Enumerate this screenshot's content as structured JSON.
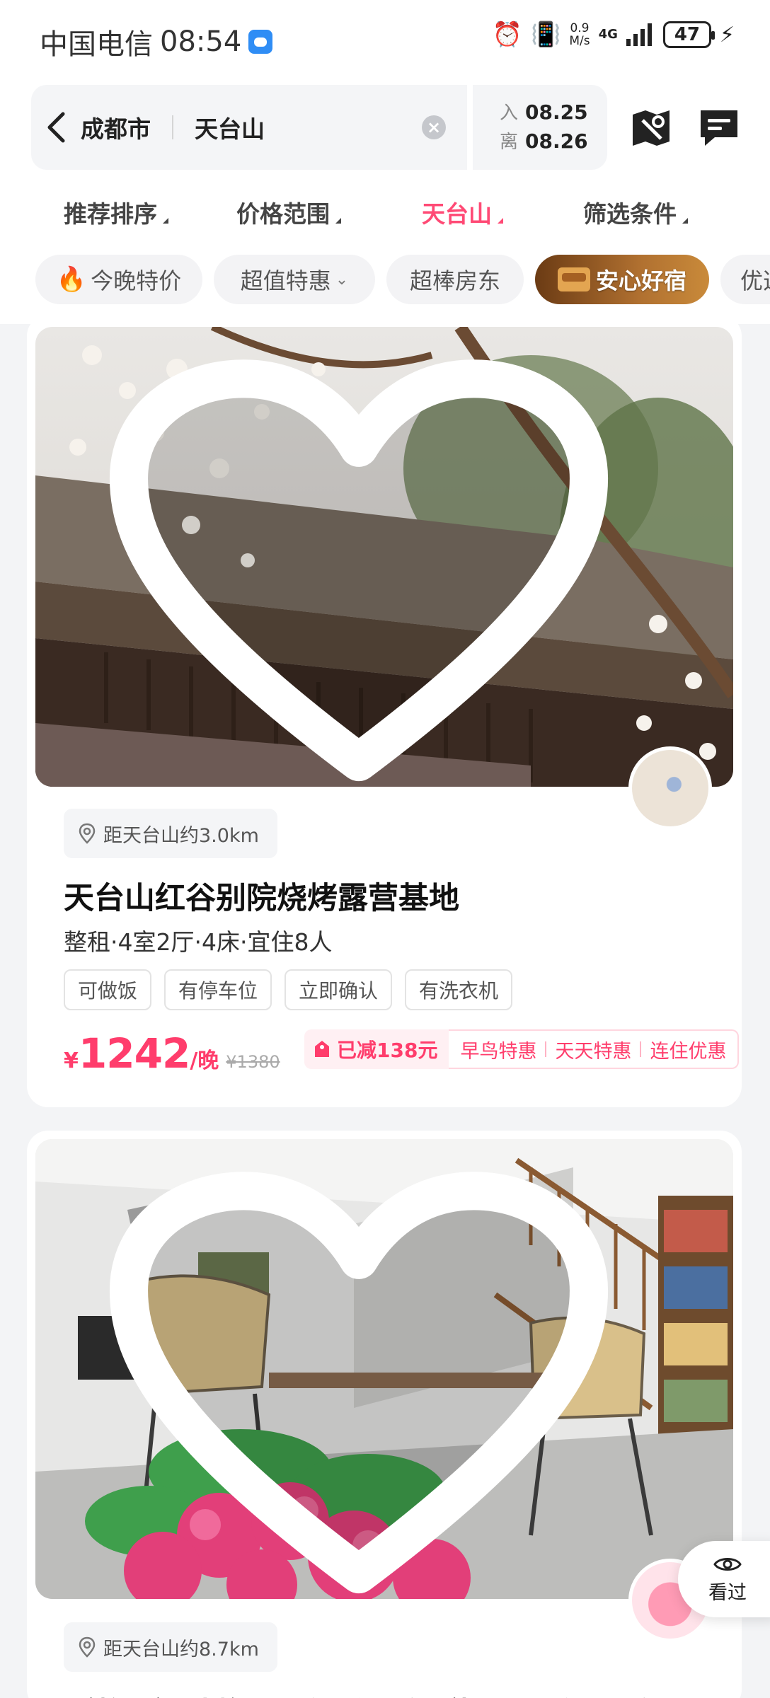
{
  "status_bar": {
    "carrier": "中国电信",
    "time": "08:54",
    "speed_value": "0.9",
    "speed_unit": "M/s",
    "network": "4G",
    "battery": "47"
  },
  "search": {
    "city": "成都市",
    "keyword": "天台山",
    "checkin_label": "入",
    "checkin_date": "08.25",
    "checkout_label": "离",
    "checkout_date": "08.26"
  },
  "filters": [
    {
      "label": "推荐排序",
      "active": false
    },
    {
      "label": "价格范围",
      "active": false
    },
    {
      "label": "天台山",
      "active": true
    },
    {
      "label": "筛选条件",
      "active": false
    }
  ],
  "chips": [
    "今晚特价",
    "超值特惠",
    "超棒房东",
    "安心好宿",
    "优选"
  ],
  "listings": [
    {
      "distance": "距天台山约3.0km",
      "title": "天台山红谷别院烧烤露营基地",
      "subtitle": "整租·4室2厅·4床·宜住8人",
      "amenities": [
        "可做饭",
        "有停车位",
        "立即确认",
        "有洗衣机"
      ],
      "currency": "¥",
      "price": "1242",
      "unit": "/晚",
      "original_price": "¥1380",
      "discount": "已减138元",
      "promos": [
        "早鸟特惠",
        "天天特惠",
        "连住优惠"
      ]
    },
    {
      "distance": "距天台山约8.7km",
      "title": "（整租）独栋loft复式一个（投影/影视/K歌/"
    }
  ],
  "seen_label": "看过",
  "colors": {
    "accent": "#ff3d6c",
    "active_tab": "#ff4a75",
    "gold_chip": "#b07030"
  }
}
